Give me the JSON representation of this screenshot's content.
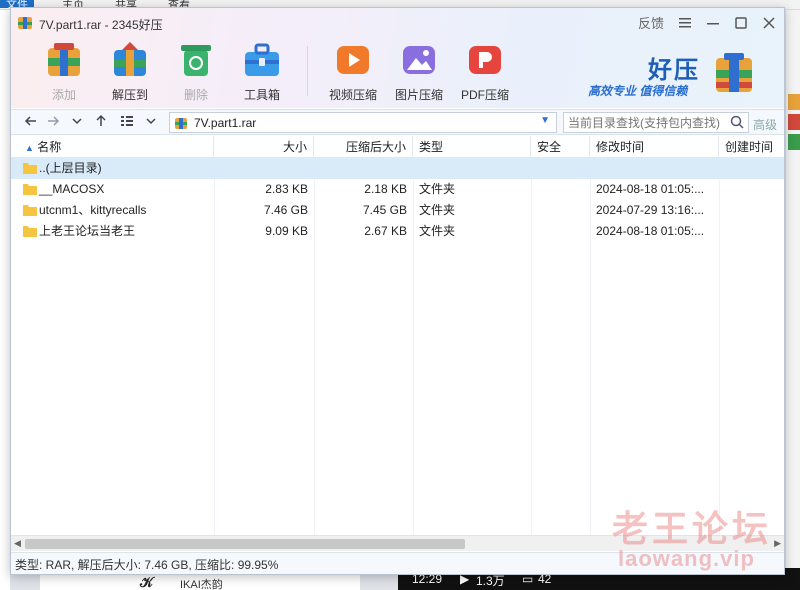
{
  "background": {
    "ribbon_tabs": [
      "文件",
      "主页",
      "共享",
      "查看"
    ],
    "bottom_left_text": "IKAI杰韵",
    "bottom_right": {
      "time": "12:29",
      "plays": "1.3万",
      "comments": "42"
    }
  },
  "window": {
    "title": "7V.part1.rar - 2345好压",
    "feedback": "反馈",
    "toolbar": [
      {
        "label": "添加",
        "icon": "add-archive-icon",
        "enabled": false,
        "color": "#e05a3a"
      },
      {
        "label": "解压到",
        "icon": "extract-icon",
        "enabled": true,
        "color": "#1e8fd6"
      },
      {
        "label": "删除",
        "icon": "delete-icon",
        "enabled": false,
        "color": "#3ab36e"
      },
      {
        "label": "工具箱",
        "icon": "toolbox-icon",
        "enabled": true,
        "color": "#2e86d8"
      },
      {
        "label": "视频压缩",
        "icon": "video-compress-icon",
        "enabled": true,
        "color": "#f07a2a"
      },
      {
        "label": "图片压缩",
        "icon": "image-compress-icon",
        "enabled": true,
        "color": "#8a6ee0"
      },
      {
        "label": "PDF压缩",
        "icon": "pdf-compress-icon",
        "enabled": true,
        "color": "#e5453c"
      }
    ],
    "brand": {
      "name": "好压",
      "slogan": "高效专业  值得信赖"
    }
  },
  "nav": {
    "address": "7V.part1.rar",
    "search_placeholder": "当前目录查找(支持包内查找)",
    "advanced": "高级"
  },
  "table": {
    "headers": [
      "名称",
      "大小",
      "压缩后大小",
      "类型",
      "安全",
      "修改时间",
      "创建时间"
    ],
    "rows": [
      {
        "name": "..(上层目录)",
        "size": "",
        "packed": "",
        "type": "",
        "security": "",
        "modified": "",
        "created": ""
      },
      {
        "name": "__MACOSX",
        "size": "2.83 KB",
        "packed": "2.18 KB",
        "type": "文件夹",
        "security": "",
        "modified": "2024-08-18 01:05:...",
        "created": ""
      },
      {
        "name": "utcnm1、kittyrecalls",
        "size": "7.46 GB",
        "packed": "7.45 GB",
        "type": "文件夹",
        "security": "",
        "modified": "2024-07-29 13:16:...",
        "created": ""
      },
      {
        "name": "上老王论坛当老王",
        "size": "9.09 KB",
        "packed": "2.67 KB",
        "type": "文件夹",
        "security": "",
        "modified": "2024-08-18 01:05:...",
        "created": ""
      }
    ]
  },
  "status": "类型: RAR, 解压后大小: 7.46 GB, 压缩比: 99.95%",
  "watermark": {
    "line1": "老王论坛",
    "line2": "laowang.vip"
  }
}
